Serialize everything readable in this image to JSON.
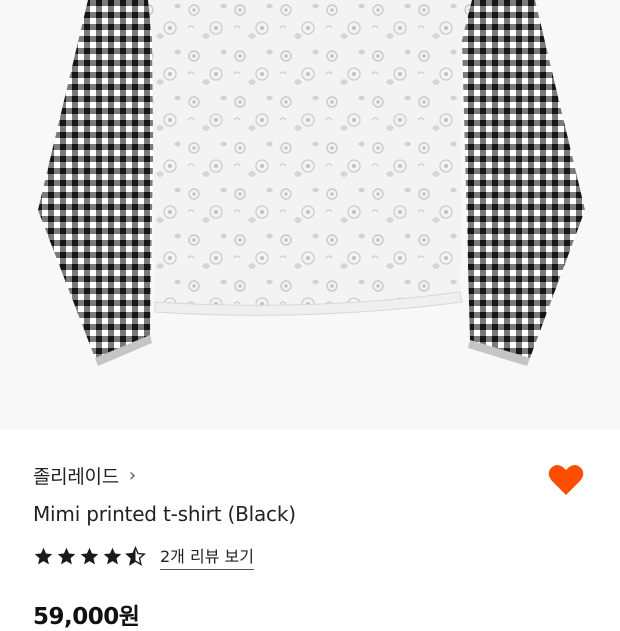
{
  "product": {
    "brand": "졸리레이드",
    "brand_chevron": "›",
    "title": "Mimi printed t-shirt (Black)",
    "rating_stars": 4.5,
    "review_link": "2개 리뷰 보기",
    "price": "59,000원"
  },
  "icons": {
    "like": "heart-icon",
    "star": "star-icon",
    "chevron": "chevron-right-icon"
  },
  "colors": {
    "like": "#ff4d00",
    "star": "#1a1a1a",
    "text": "#222222"
  }
}
